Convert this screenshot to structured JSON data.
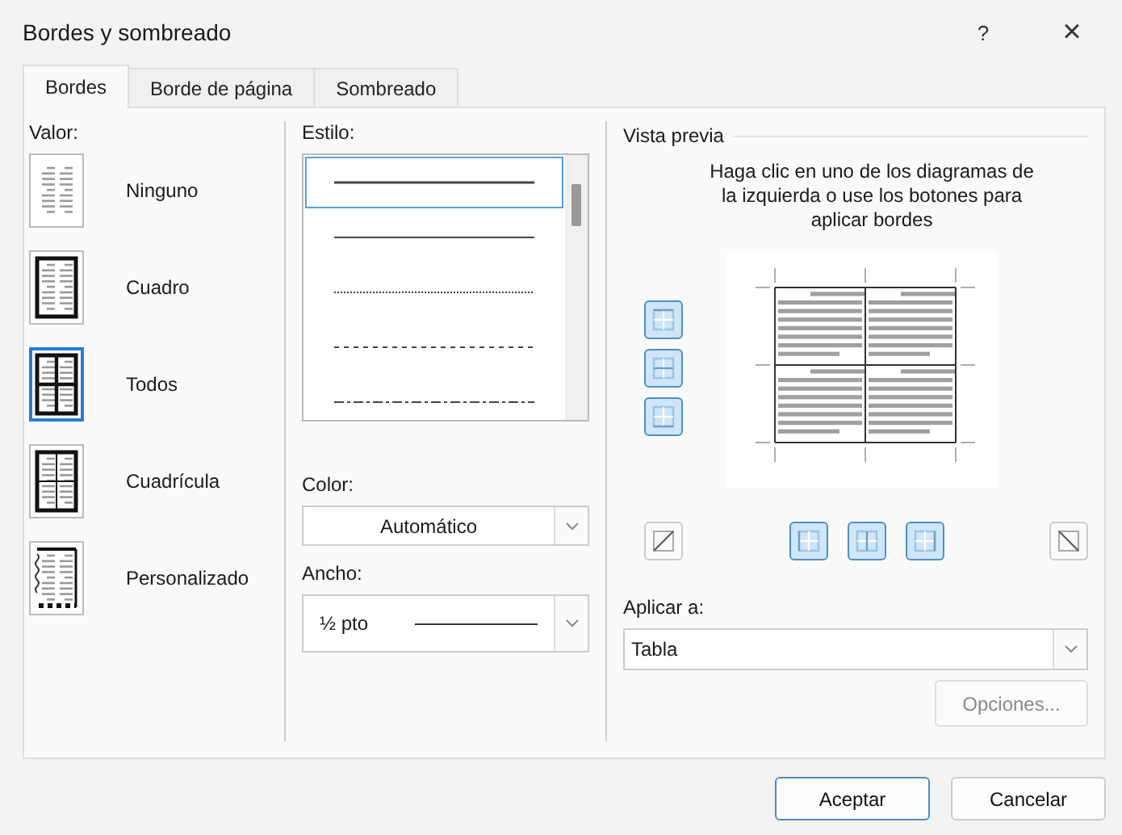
{
  "window": {
    "title": "Bordes y sombreado",
    "help_button": "?",
    "close_button": "×"
  },
  "tabs": [
    {
      "label": "Bordes",
      "selected": true
    },
    {
      "label": "Borde de página",
      "selected": false
    },
    {
      "label": "Sombreado",
      "selected": false
    }
  ],
  "setting": {
    "label": "Valor:",
    "options": [
      {
        "label": "Ninguno",
        "kind": "none",
        "selected": false
      },
      {
        "label": "Cuadro",
        "kind": "box",
        "selected": false
      },
      {
        "label": "Todos",
        "kind": "all",
        "selected": true
      },
      {
        "label": "Cuadrícula",
        "kind": "grid",
        "selected": false
      },
      {
        "label": "Personalizado",
        "kind": "custom",
        "selected": false
      }
    ]
  },
  "style": {
    "label": "Estilo:",
    "options": [
      {
        "kind": "solid",
        "selected": true
      },
      {
        "kind": "thin",
        "selected": false
      },
      {
        "kind": "dotted",
        "selected": false
      },
      {
        "kind": "dashed",
        "selected": false
      },
      {
        "kind": "dashdot",
        "selected": false
      }
    ]
  },
  "color": {
    "label": "Color:",
    "value": "Automático"
  },
  "width": {
    "label": "Ancho:",
    "value": "½ pto"
  },
  "preview": {
    "title": "Vista previa",
    "hint": "Haga clic en uno de los diagramas de la izquierda o use los botones para aplicar bordes",
    "side_buttons": [
      {
        "kind": "top",
        "on": true
      },
      {
        "kind": "inside-horizontal",
        "on": true
      },
      {
        "kind": "bottom",
        "on": true
      }
    ],
    "bottom_buttons": [
      {
        "kind": "diagonal-up",
        "on": false
      },
      {
        "kind": "left",
        "on": true
      },
      {
        "kind": "inside-vertical",
        "on": true
      },
      {
        "kind": "right",
        "on": true
      },
      {
        "kind": "diagonal-down",
        "on": false
      }
    ]
  },
  "apply_to": {
    "label": "Aplicar a:",
    "value": "Tabla"
  },
  "options_button": {
    "label": "Opciones...",
    "disabled": true
  },
  "buttons": [
    {
      "label": "Aceptar",
      "default": true
    },
    {
      "label": "Cancelar",
      "default": false
    }
  ]
}
